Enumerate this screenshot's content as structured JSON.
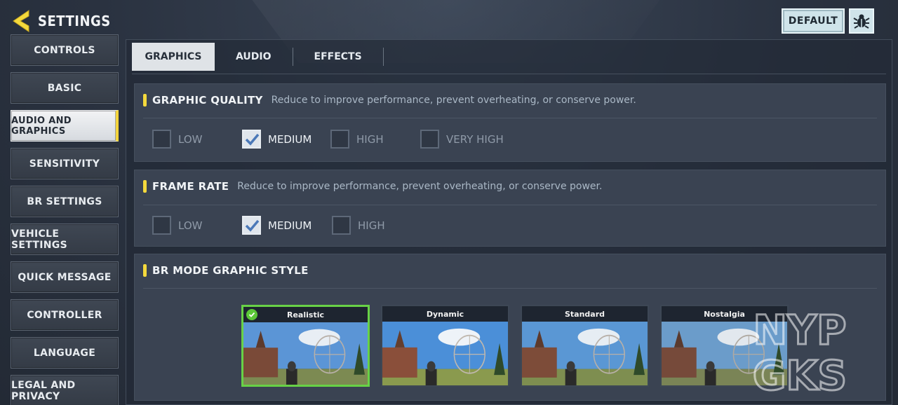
{
  "header": {
    "title": "SETTINGS"
  },
  "top_right": {
    "default_label": "DEFAULT"
  },
  "sidebar": {
    "items": [
      {
        "label": "CONTROLS"
      },
      {
        "label": "BASIC"
      },
      {
        "label": "AUDIO AND GRAPHICS"
      },
      {
        "label": "SENSITIVITY"
      },
      {
        "label": "BR SETTINGS"
      },
      {
        "label": "VEHICLE SETTINGS"
      },
      {
        "label": "QUICK MESSAGE"
      },
      {
        "label": "CONTROLLER"
      },
      {
        "label": "LANGUAGE"
      },
      {
        "label": "LEGAL AND PRIVACY"
      }
    ],
    "active_index": 2
  },
  "tabs": [
    {
      "label": "GRAPHICS"
    },
    {
      "label": "AUDIO"
    },
    {
      "label": "EFFECTS"
    }
  ],
  "graphic_quality": {
    "title": "GRAPHIC QUALITY",
    "desc": "Reduce to improve performance, prevent overheating, or conserve power.",
    "options": [
      "LOW",
      "MEDIUM",
      "HIGH",
      "VERY HIGH"
    ],
    "selected": "MEDIUM"
  },
  "frame_rate": {
    "title": "FRAME RATE",
    "desc": "Reduce to improve performance, prevent overheating, or conserve power.",
    "options": [
      "LOW",
      "MEDIUM",
      "HIGH"
    ],
    "selected": "MEDIUM"
  },
  "br_mode": {
    "title": "BR MODE GRAPHIC STYLE",
    "styles": [
      "Realistic",
      "Dynamic",
      "Standard",
      "Nostalgia"
    ],
    "selected": "Realistic"
  },
  "colors": {
    "accent": "#f4d93c",
    "selected_border": "#68d246"
  },
  "watermark": {
    "line1": "NYP",
    "line2": "GKS"
  }
}
